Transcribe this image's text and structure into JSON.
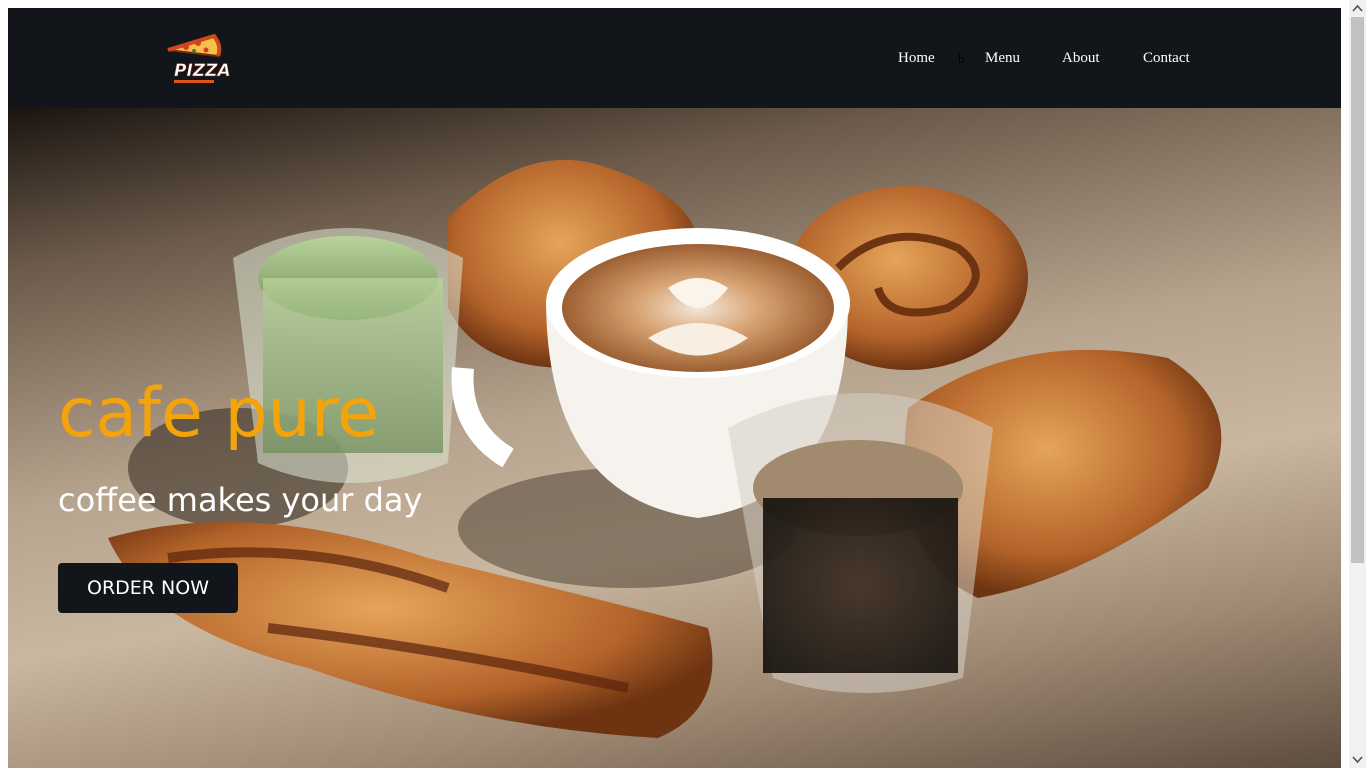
{
  "header": {
    "logo_text": "PIZZA",
    "nav": {
      "home": "Home",
      "stray": "b",
      "menu": "Menu",
      "about": "About",
      "contact": "Contact"
    }
  },
  "hero": {
    "title": "cafe pure",
    "subtitle": "coffee makes your day",
    "cta_label": "ORDER NOW"
  },
  "colors": {
    "header_bg": "#121519",
    "title_accent": "#f5a30a",
    "button_bg": "#121519"
  },
  "icons": {
    "logo": "pizza-slice-logo",
    "scroll_up": "chevron-up-icon",
    "scroll_down": "chevron-down-icon"
  }
}
